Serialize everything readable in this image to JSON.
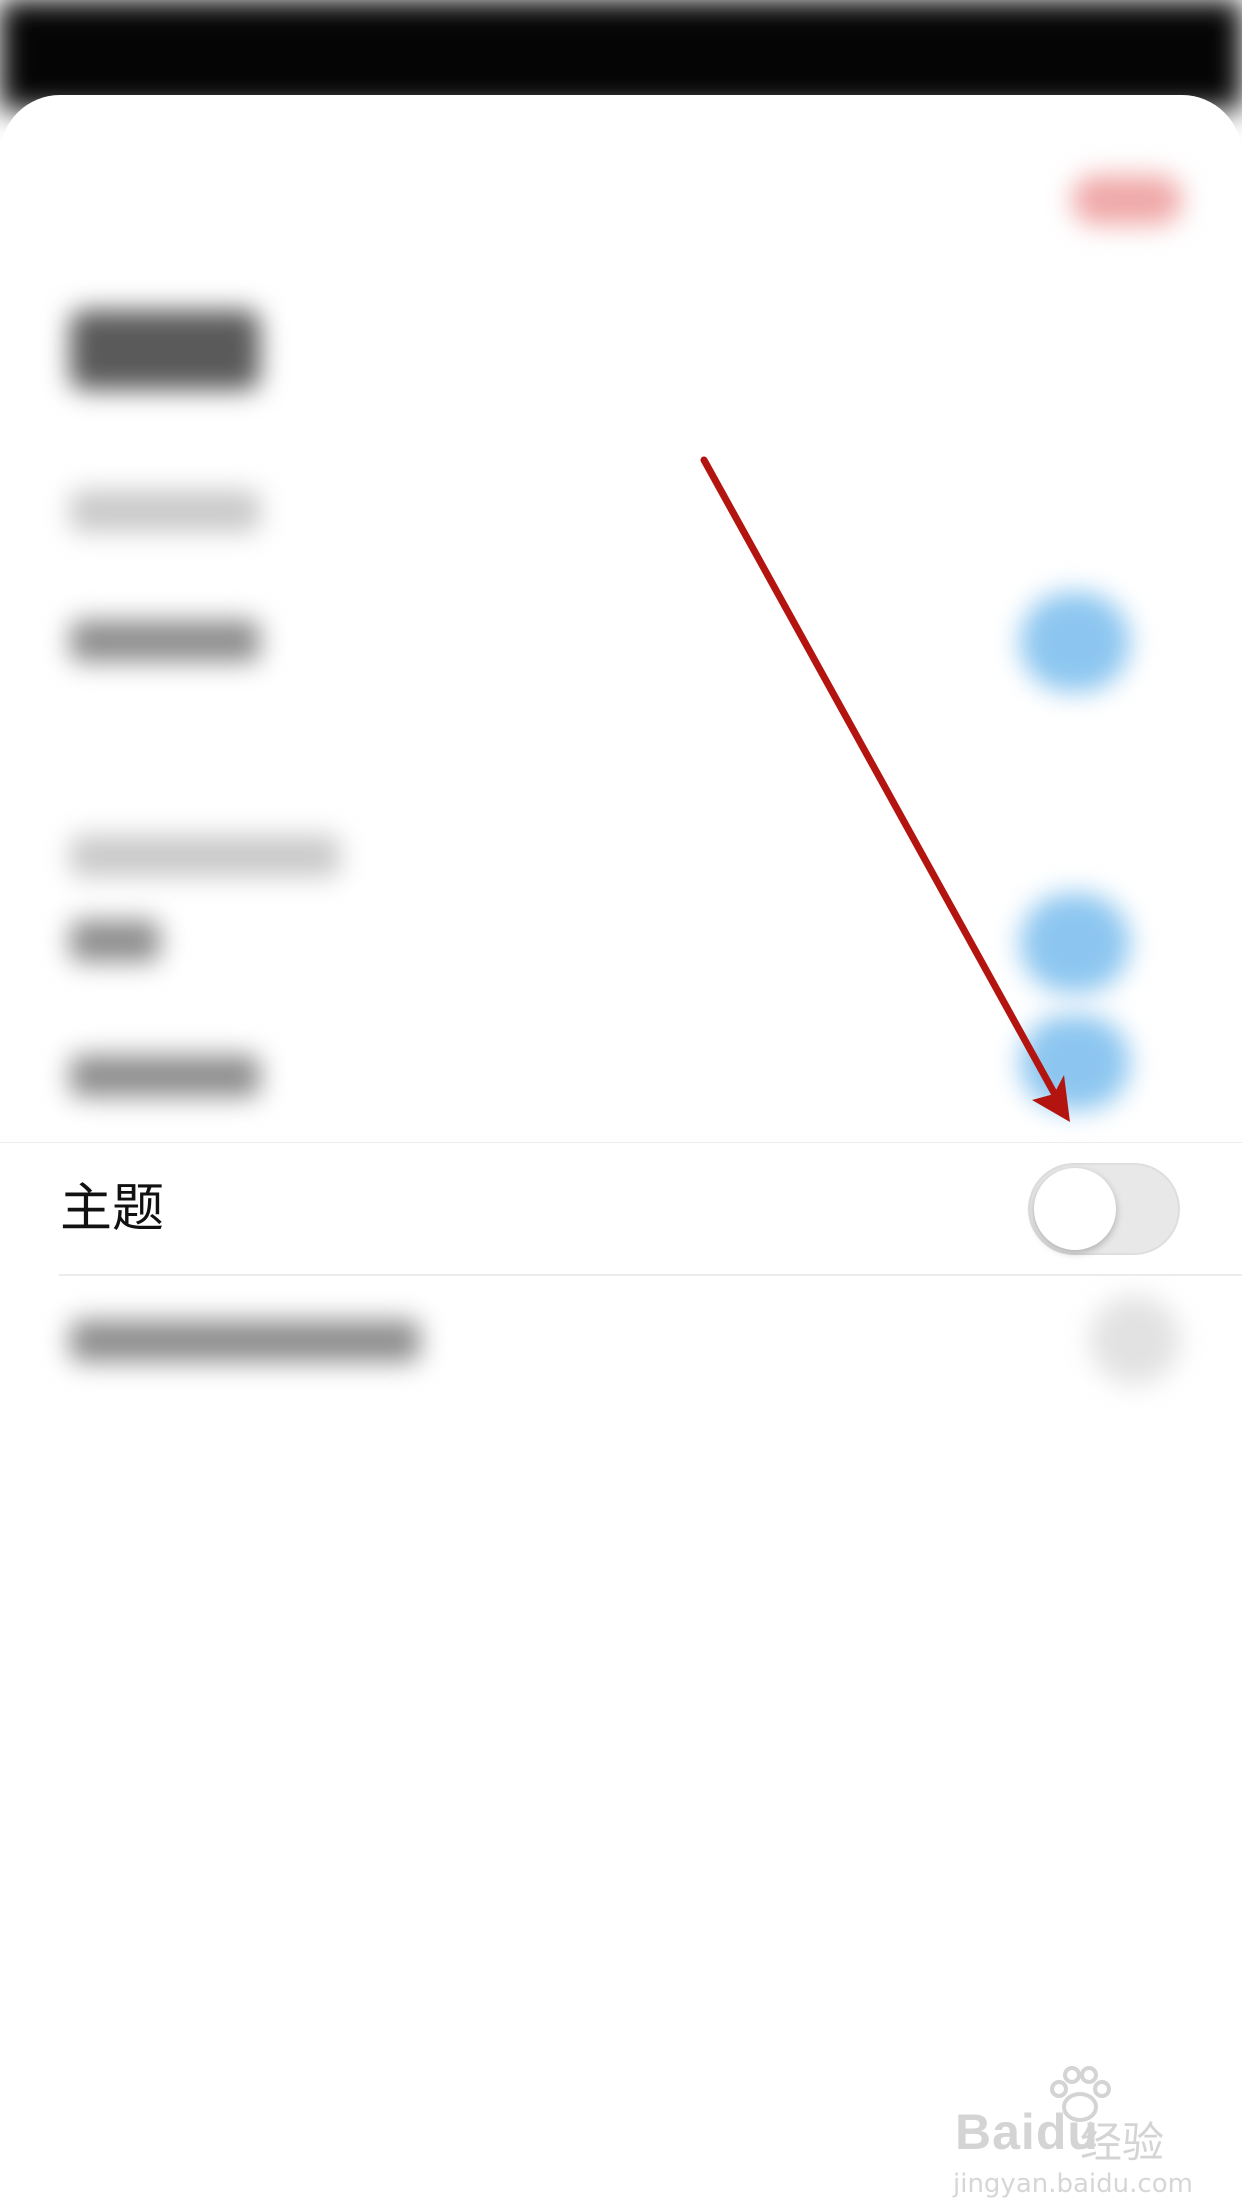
{
  "settings": {
    "theme_row": {
      "label": "主题",
      "toggle_on": false
    }
  },
  "annotation": {
    "arrow_color": "#b3140f"
  },
  "watermark": {
    "brand": "Bai",
    "brand_suffix": "du",
    "label": "经验",
    "url": "jingyan.baidu.com"
  }
}
